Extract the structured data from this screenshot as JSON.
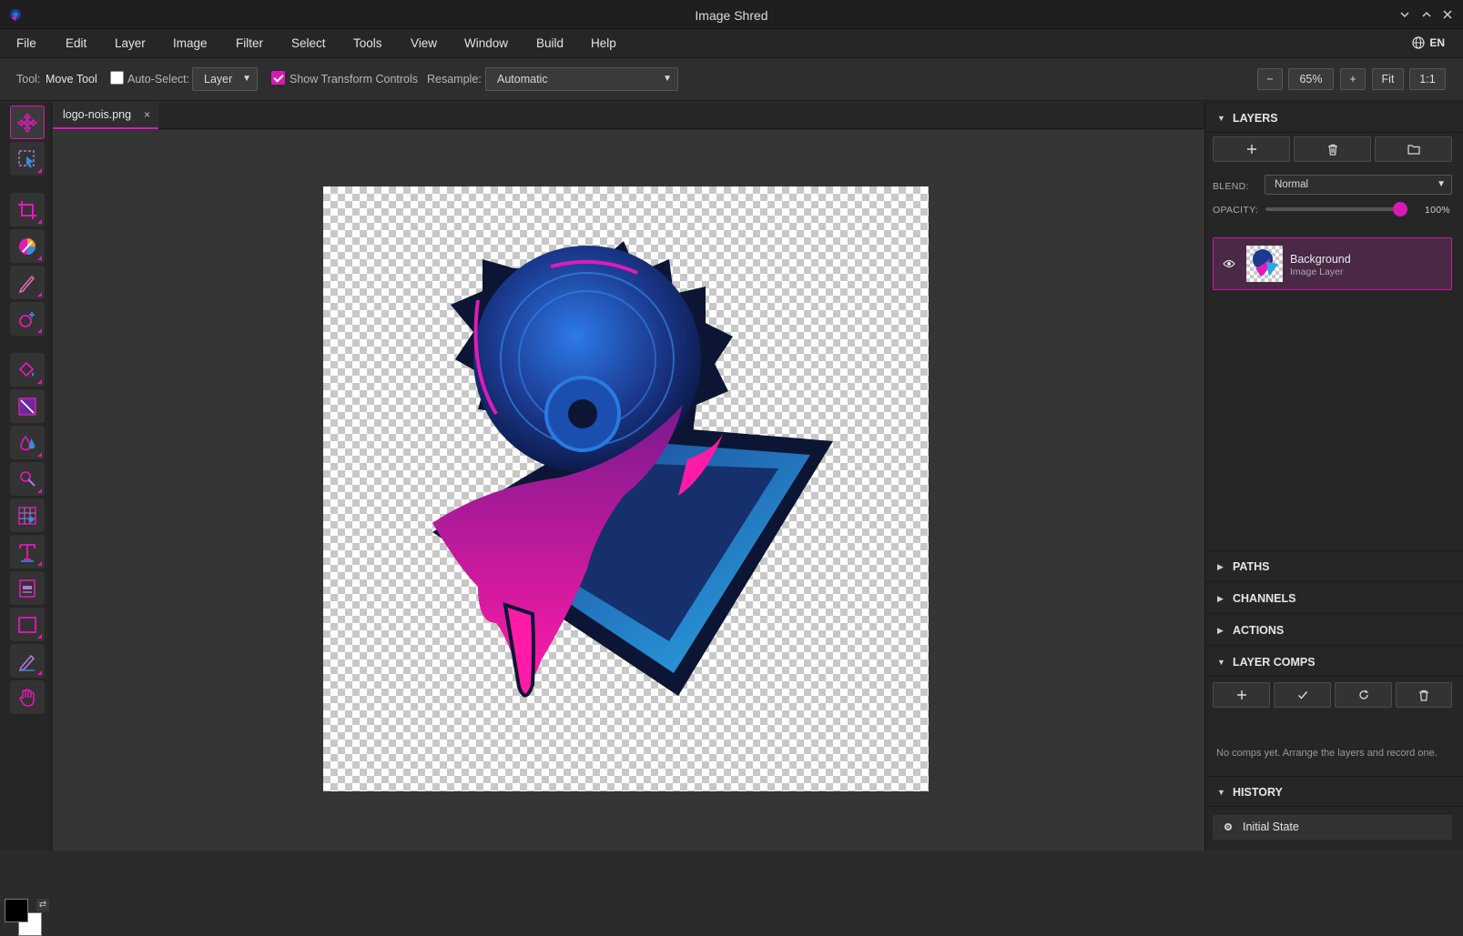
{
  "window": {
    "title": "Image Shred",
    "controls": [
      "minimize-icon",
      "maximize-icon",
      "close-icon"
    ]
  },
  "menu": {
    "items": [
      "File",
      "Edit",
      "Layer",
      "Image",
      "Filter",
      "Select",
      "Tools",
      "View",
      "Window",
      "Build",
      "Help"
    ],
    "language": "EN"
  },
  "options": {
    "tool_label": "Tool:",
    "tool_name": "Move Tool",
    "auto_select_label": "Auto-Select:",
    "auto_select_checked": false,
    "auto_select_value": "Layer",
    "show_transform_label": "Show Transform Controls",
    "show_transform_checked": true,
    "resample_label": "Resample:",
    "resample_value": "Automatic",
    "zoom_out": "−",
    "zoom_value": "65%",
    "zoom_in": "+",
    "fit": "Fit",
    "actual": "1:1"
  },
  "tools": [
    "move-tool",
    "selection-tool",
    "crop-tool",
    "color-picker-tool",
    "brush-tool",
    "shape-tool",
    "fill-tool",
    "gradient-tool",
    "dodge-tool",
    "clone-tool",
    "pattern-tool",
    "text-tool",
    "frame-tool",
    "rectangle-tool",
    "pen-tool",
    "hand-tool"
  ],
  "colors": {
    "foreground": "#000000",
    "background": "#ffffff",
    "accent": "#d81ab5"
  },
  "document": {
    "tab_name": "logo-nois.png",
    "close": "×"
  },
  "panels": {
    "layers": {
      "title": "LAYERS",
      "blend_label": "BLEND:",
      "blend_value": "Normal",
      "opacity_label": "OPACITY:",
      "opacity_value": "100%",
      "opacity_fraction": 1.0,
      "layer_items": [
        {
          "name": "Background",
          "type": "Image Layer",
          "visible": true,
          "selected": true
        }
      ]
    },
    "paths": {
      "title": "PATHS"
    },
    "channels": {
      "title": "CHANNELS"
    },
    "actions": {
      "title": "ACTIONS"
    },
    "layer_comps": {
      "title": "LAYER COMPS",
      "empty_text": "No comps yet. Arrange the layers and record one."
    },
    "history": {
      "title": "HISTORY",
      "items": [
        "Initial State"
      ]
    }
  }
}
